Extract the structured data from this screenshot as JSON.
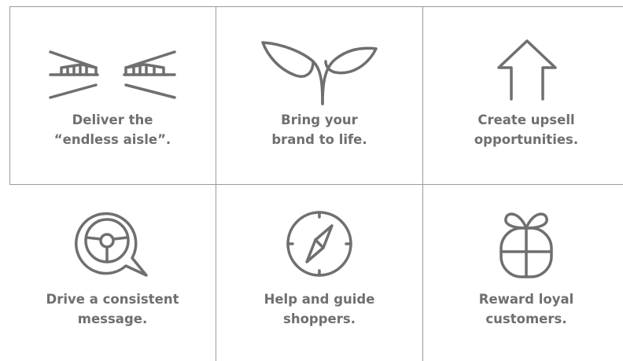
{
  "colors": {
    "icon": "#6f6f70",
    "text": "#6f6f70",
    "grid": "#9a9a9a",
    "background": "#ffffff"
  },
  "features": [
    {
      "icon": "endless-aisle-icon",
      "line1": "Deliver the",
      "line2": "“endless aisle”."
    },
    {
      "icon": "sprout-icon",
      "line1": "Bring your",
      "line2": "brand to life."
    },
    {
      "icon": "house-arrow-icon",
      "line1": "Create upsell",
      "line2": "opportunities."
    },
    {
      "icon": "steering-wheel-bubble-icon",
      "line1": "Drive a consistent",
      "line2": "message."
    },
    {
      "icon": "compass-icon",
      "line1": "Help and guide",
      "line2": "shoppers."
    },
    {
      "icon": "gift-icon",
      "line1": "Reward loyal",
      "line2": "customers."
    }
  ]
}
